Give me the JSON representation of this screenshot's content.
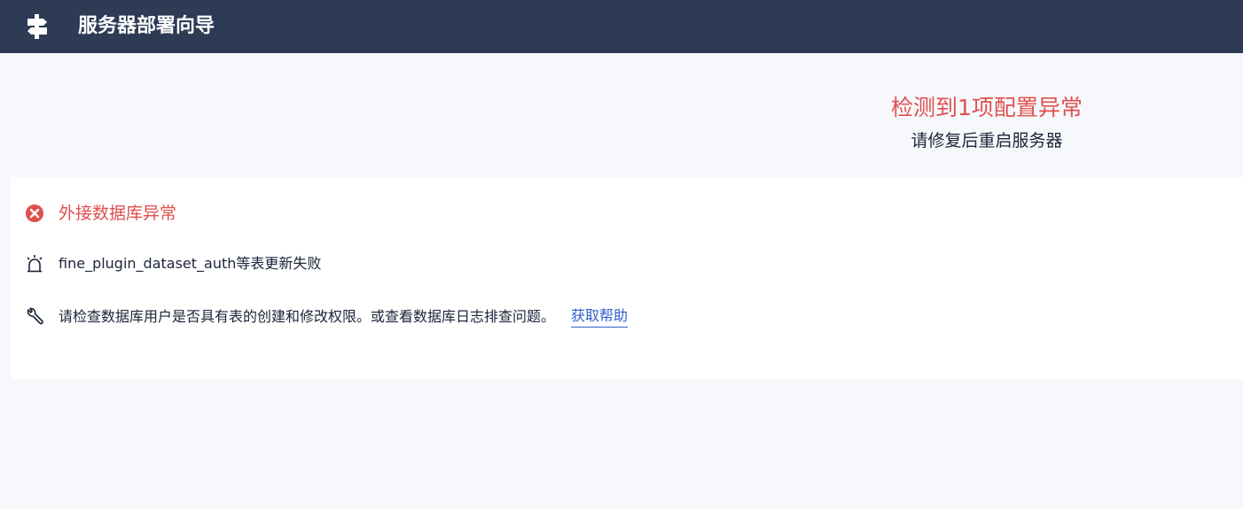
{
  "header": {
    "title": "服务器部署向导",
    "logo_icon": "signpost-icon",
    "background": "#2d3b55"
  },
  "summary": {
    "headline": "检测到1项配置异常",
    "subtext": "请修复后重启服务器",
    "headline_color": "#e04f4f"
  },
  "issue": {
    "title": "外接数据库异常",
    "title_icon": "error-circle-icon",
    "detail": "fine_plugin_dataset_auth等表更新失败",
    "detail_icon": "alarm-icon",
    "suggestion": "请检查数据库用户是否具有表的创建和修改权限。或查看数据库日志排查问题。",
    "suggestion_icon": "wrench-icon",
    "help_link": "获取帮助",
    "link_color": "#2f5ecf"
  }
}
